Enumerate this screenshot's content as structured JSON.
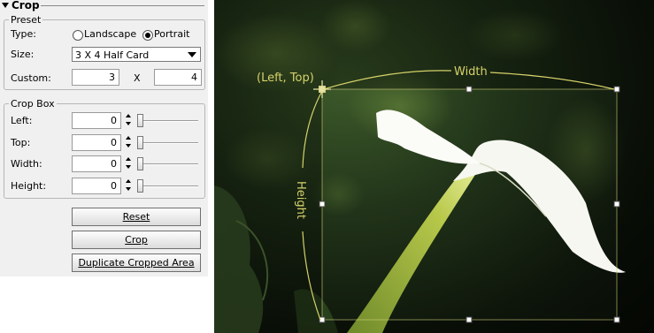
{
  "panel": {
    "title": "Crop",
    "preset": {
      "legend": "Preset",
      "type_label": "Type:",
      "orientation_options": [
        {
          "label": "Landscape",
          "selected": false
        },
        {
          "label": "Portrait",
          "selected": true
        }
      ],
      "size_label": "Size:",
      "size_value": "3 X 4 Half Card",
      "custom_label": "Custom:",
      "custom_width": "3",
      "custom_separator": "X",
      "custom_height": "4"
    },
    "crop_box": {
      "legend": "Crop Box",
      "rows": [
        {
          "label": "Left:",
          "value": "0"
        },
        {
          "label": "Top:",
          "value": "0"
        },
        {
          "label": "Width:",
          "value": "0"
        },
        {
          "label": "Height:",
          "value": "0"
        }
      ]
    },
    "buttons": {
      "reset": "Reset",
      "crop": "Crop",
      "duplicate": "Duplicate Cropped Area"
    }
  },
  "canvas": {
    "left_top_label": "(Left, Top)",
    "width_label": "Width",
    "height_label": "Height",
    "guide_color": "#d6d26a",
    "handle_color": "#ffffff"
  }
}
